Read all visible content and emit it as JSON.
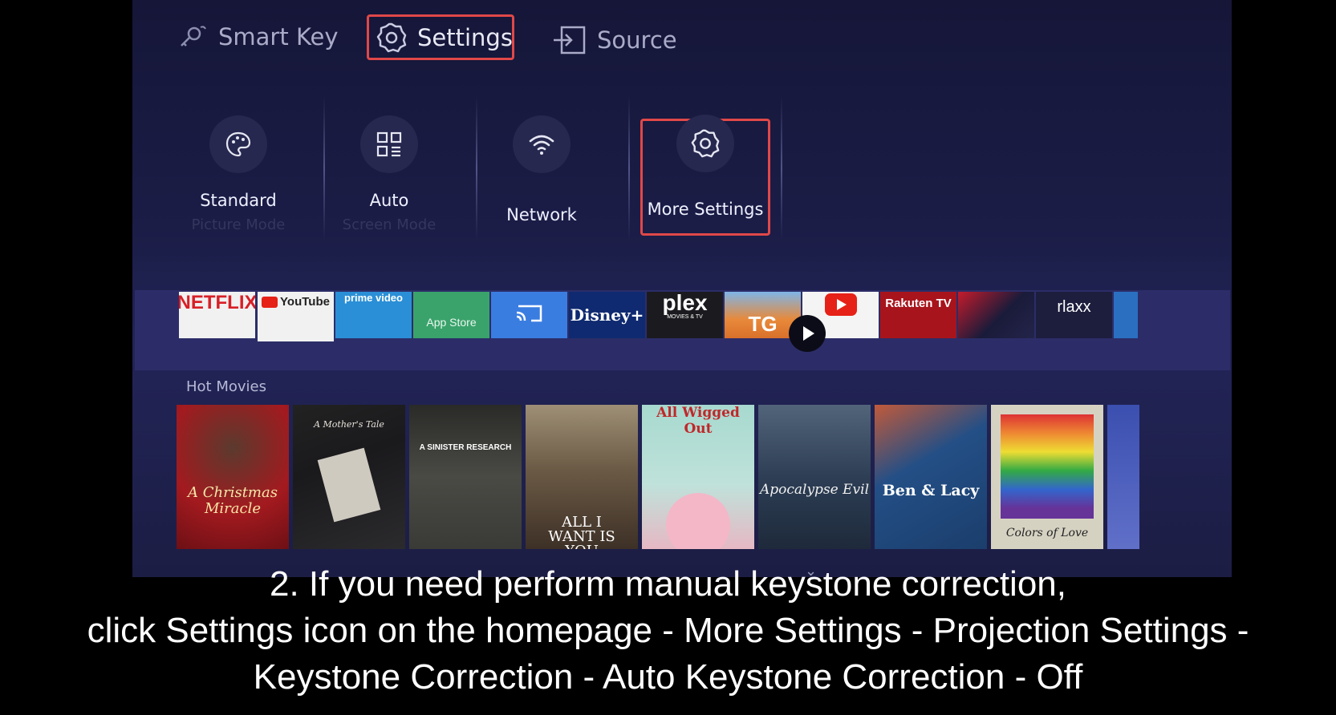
{
  "nav": {
    "smart_key": "Smart Key",
    "settings": "Settings",
    "source": "Source"
  },
  "quick_settings": [
    {
      "label": "Standard",
      "sub": "Picture Mode",
      "icon": "palette-icon"
    },
    {
      "label": "Auto",
      "sub": "Screen Mode",
      "icon": "grid-icon"
    },
    {
      "label": "Network",
      "sub": "",
      "icon": "wifi-icon"
    },
    {
      "label": "More Settings",
      "sub": "",
      "icon": "gear-icon"
    }
  ],
  "apps": [
    "NETFLIX",
    "YouTube",
    "prime video",
    "App Store",
    "Cast",
    "Disney+",
    "plex",
    "TG",
    "YouTube",
    "Rakuten TV",
    "",
    "rlaxx"
  ],
  "apps_sub": {
    "plex": "MOVIES & TV"
  },
  "hot_movies": {
    "title": "Hot Movies",
    "posters": [
      {
        "text": "A Christmas Miracle",
        "bg": "#a31a1f"
      },
      {
        "text": "A Mother's Tale",
        "bg": "#1e1d20"
      },
      {
        "text": "A SINISTER RESEARCH",
        "bg": "#3c3c38"
      },
      {
        "text": "ALL I WANT IS YOU",
        "bg": "#6b5a45"
      },
      {
        "text": "All Wigged Out",
        "bg": "#a7d9cf"
      },
      {
        "text": "Apocalypse Evil",
        "bg": "#2d3e55"
      },
      {
        "text": "Ben & Lacy",
        "bg": "#234f86"
      },
      {
        "text": "Colors of Love",
        "bg": "#d6d2c2"
      }
    ]
  },
  "caption": {
    "line1": "2. If you need perform manual keystone correction,",
    "line2": "click Settings icon on the homepage - More Settings - Projection Settings -",
    "line3": "Keystone Correction - Auto Keystone Correction - Off"
  },
  "colors": {
    "highlight": "#e04848",
    "background": "#1b1d47"
  }
}
